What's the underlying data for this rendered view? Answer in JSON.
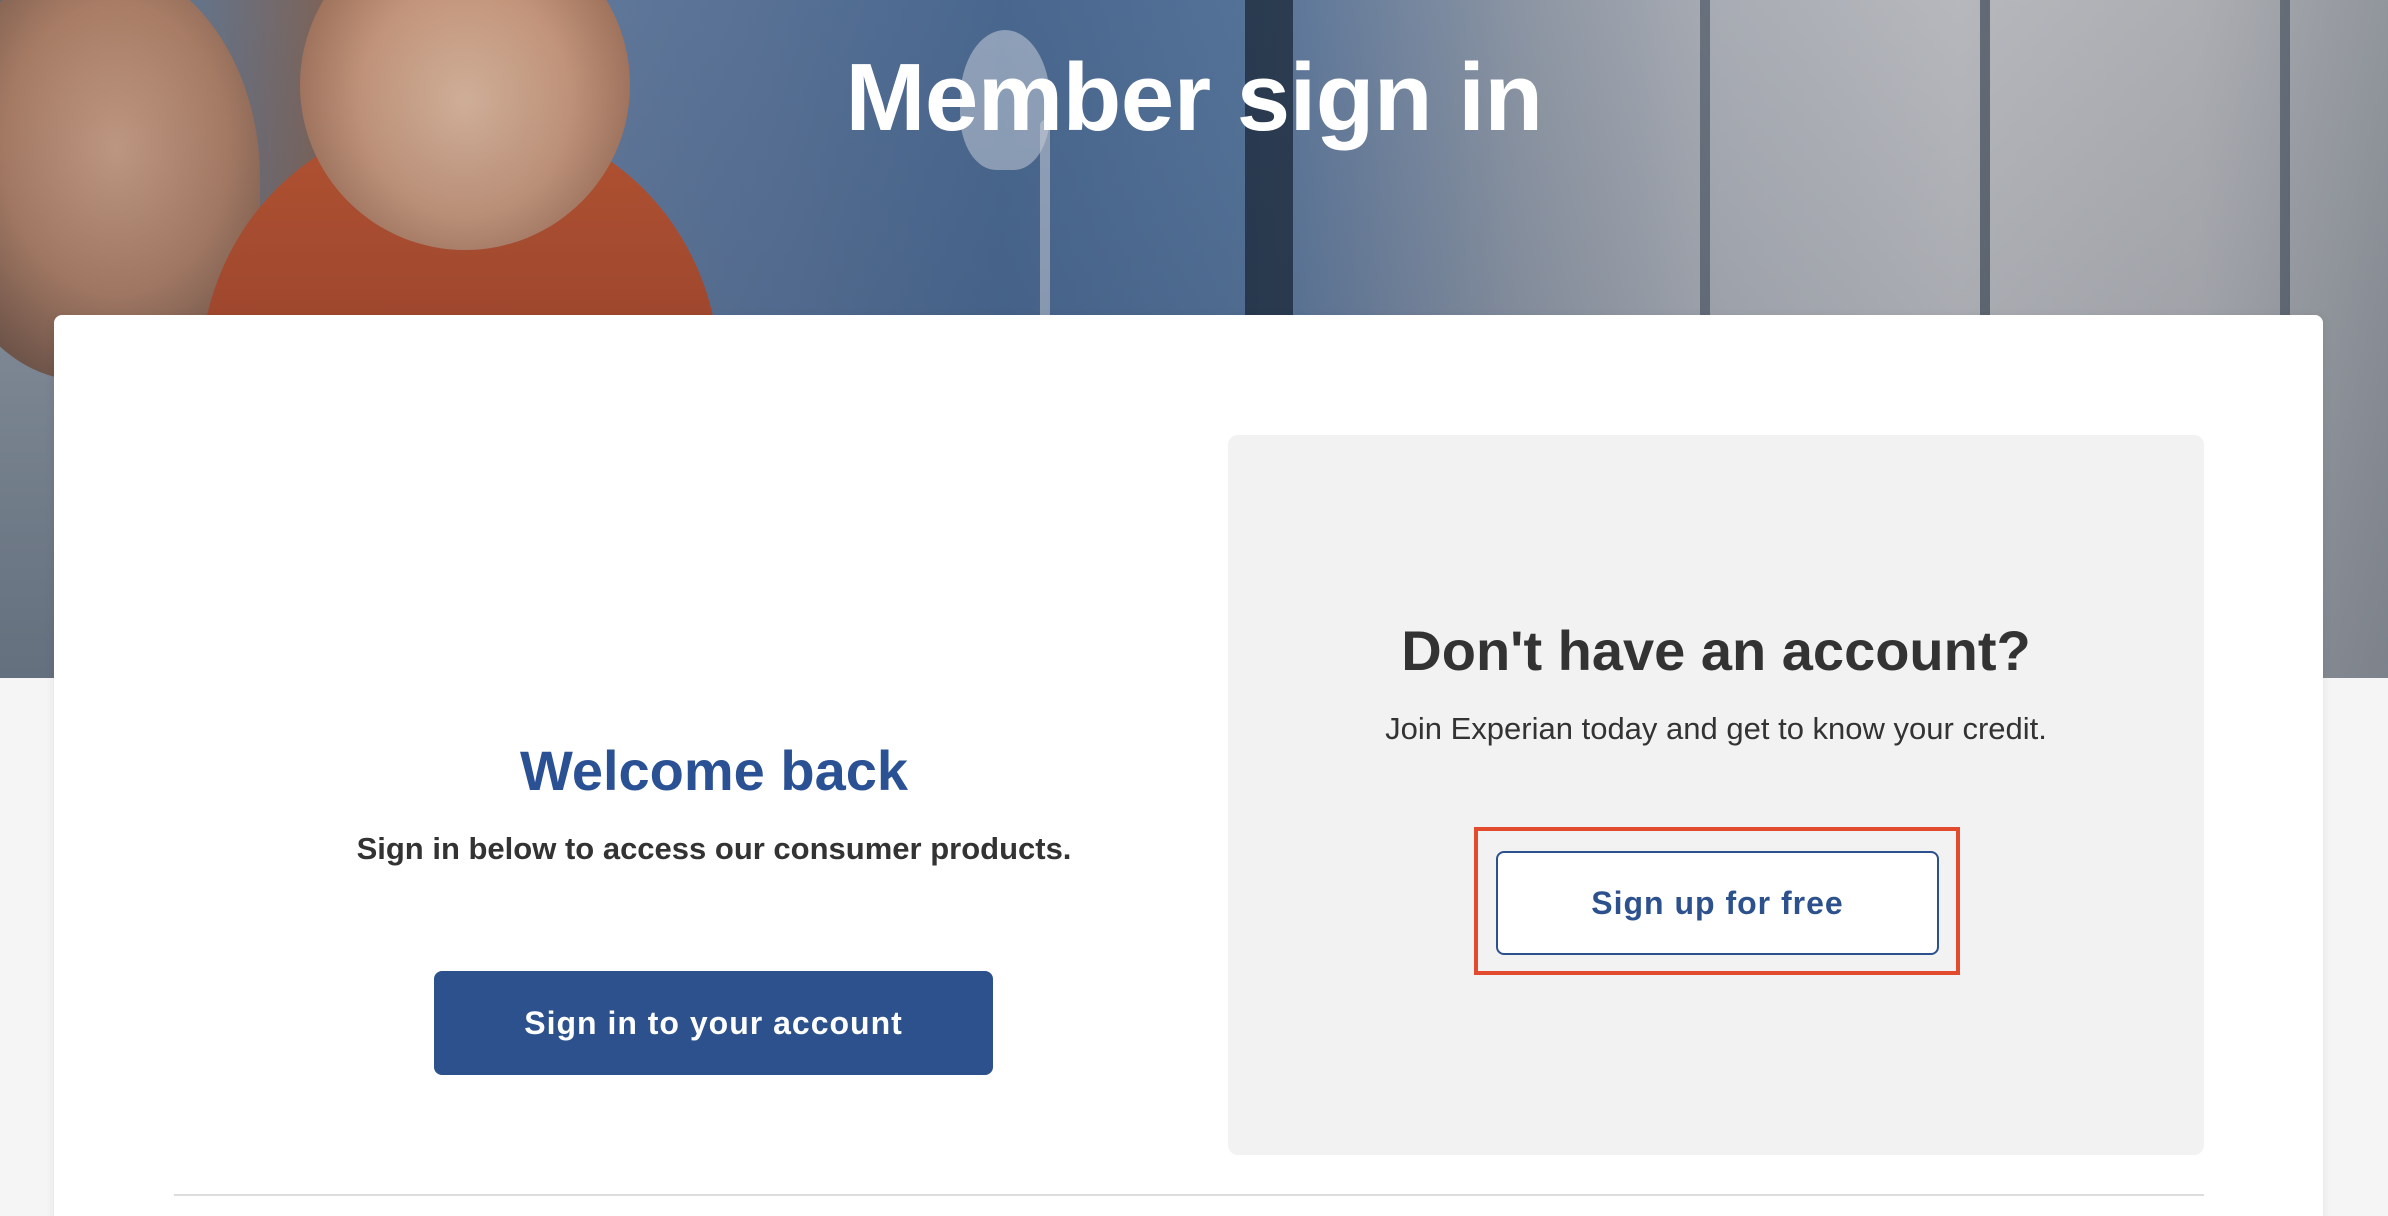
{
  "hero": {
    "title": "Member sign in"
  },
  "signin": {
    "title": "Welcome back",
    "subtitle": "Sign in below to access our consumer products.",
    "button_label": "Sign in to your account"
  },
  "signup": {
    "title": "Don't have an account?",
    "subtitle": "Join Experian today and get to know your credit.",
    "button_label": "Sign up for free"
  },
  "colors": {
    "brand_blue": "#2c518d",
    "heading_blue": "#2a5194",
    "highlight": "#e34b2e",
    "panel_gray": "#f2f2f2"
  }
}
